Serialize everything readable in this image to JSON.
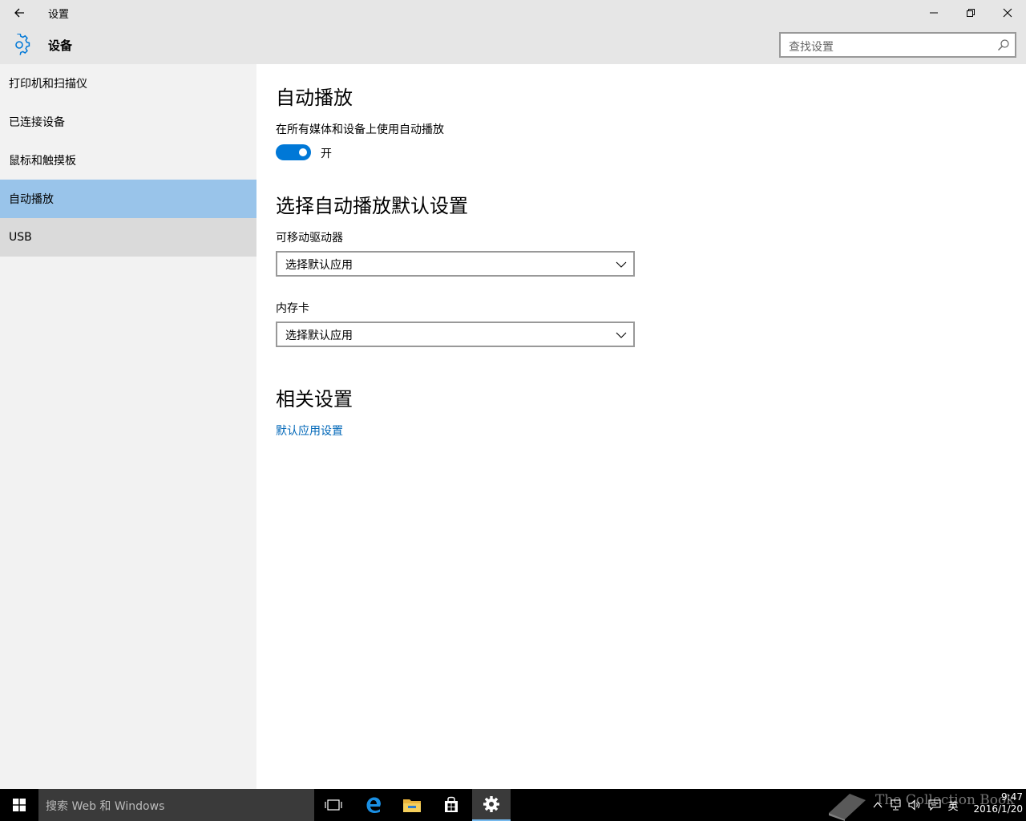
{
  "window": {
    "title": "设置"
  },
  "header": {
    "title": "设备",
    "search_placeholder": "查找设置"
  },
  "sidebar": {
    "items": [
      {
        "label": "打印机和扫描仪"
      },
      {
        "label": "已连接设备"
      },
      {
        "label": "鼠标和触摸板"
      },
      {
        "label": "自动播放",
        "selected": true
      },
      {
        "label": "USB",
        "hovered": true
      }
    ]
  },
  "main": {
    "autoplay_heading": "自动播放",
    "autoplay_toggle_label": "在所有媒体和设备上使用自动播放",
    "autoplay_toggle_state": "开",
    "autoplay_toggle_on": true,
    "defaults_heading": "选择自动播放默认设置",
    "removable_drive_label": "可移动驱动器",
    "removable_drive_value": "选择默认应用",
    "memory_card_label": "内存卡",
    "memory_card_value": "选择默认应用",
    "related_heading": "相关设置",
    "default_apps_link": "默认应用设置"
  },
  "taskbar": {
    "search_placeholder": "搜索 Web 和 Windows",
    "ime": "英",
    "time": "9:47",
    "date": "2016/1/20",
    "watermark": "The Collection Book"
  },
  "colors": {
    "accent": "#0078d7",
    "selected_nav": "#99c4ea",
    "link": "#0067b8",
    "chrome": "#e6e6e6",
    "sidebar": "#f2f2f2"
  },
  "icons": [
    "back-arrow-icon",
    "minimize-icon",
    "restore-icon",
    "close-icon",
    "gear-icon",
    "search-icon",
    "chevron-down-icon",
    "windows-logo-icon",
    "task-view-icon",
    "edge-icon",
    "file-explorer-icon",
    "store-icon",
    "settings-gear-icon",
    "chevron-up-icon",
    "network-icon",
    "volume-icon",
    "action-center-icon"
  ]
}
